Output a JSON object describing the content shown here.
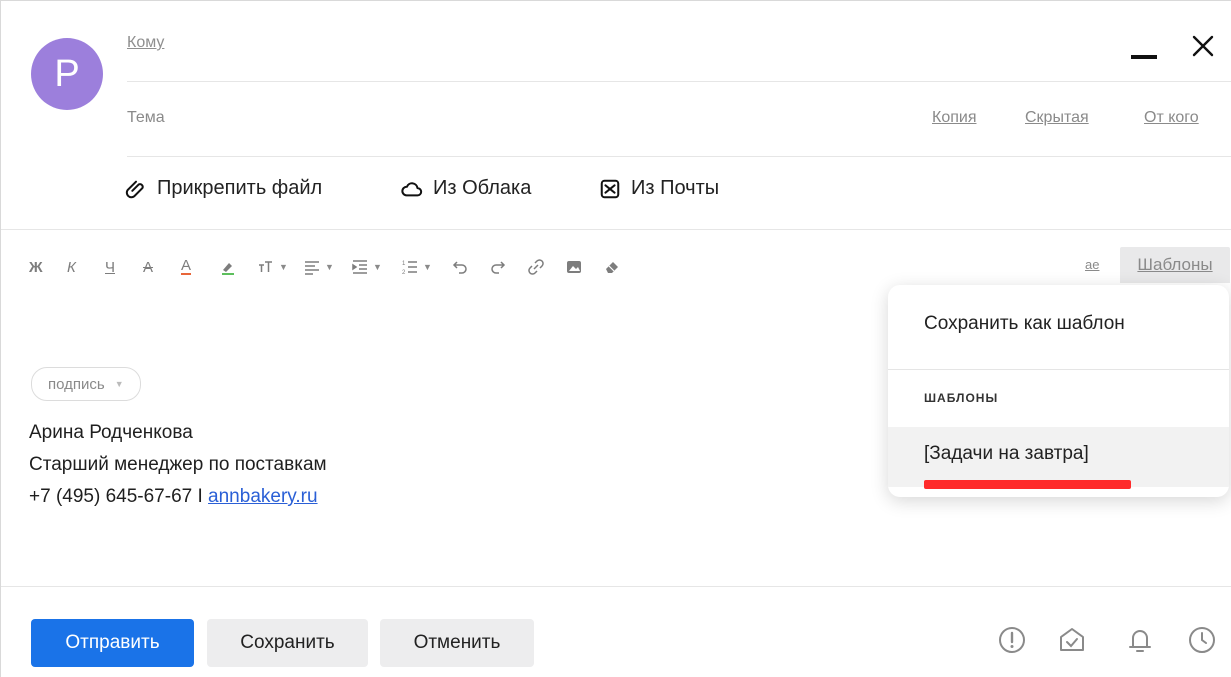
{
  "avatar": {
    "letter": "P",
    "color": "#9c7fdc"
  },
  "fields": {
    "to_label": "Кому",
    "subject_label": "Тема",
    "cc_label": "Копия",
    "bcc_label": "Скрытая",
    "from_label": "От кого"
  },
  "attachments": {
    "file_label": "Прикрепить файл",
    "cloud_label": "Из Облака",
    "mail_label": "Из Почты"
  },
  "toolbar": {
    "bold": "Ж",
    "italic": "К",
    "underline": "Ч",
    "strike": "А",
    "text_color": "А",
    "templates_label": "Шаблоны",
    "spell_icon_text": "ае"
  },
  "signature": {
    "chip_label": "подпись",
    "name": "Арина Родченкова",
    "position": "Старший менеджер по поставкам",
    "phone": "+7 (495) 645-67-67 I",
    "site": "annbakery.ru"
  },
  "templates_menu": {
    "save_as_template": "Сохранить как шаблон",
    "heading": "ШАБЛОНЫ",
    "items": [
      "[Задачи на завтра]"
    ]
  },
  "actions": {
    "send": "Отправить",
    "save": "Сохранить",
    "cancel": "Отменить"
  },
  "colors": {
    "accent": "#1a73e8",
    "highlight": "#ff2b2b",
    "link": "#2a5fd6"
  }
}
